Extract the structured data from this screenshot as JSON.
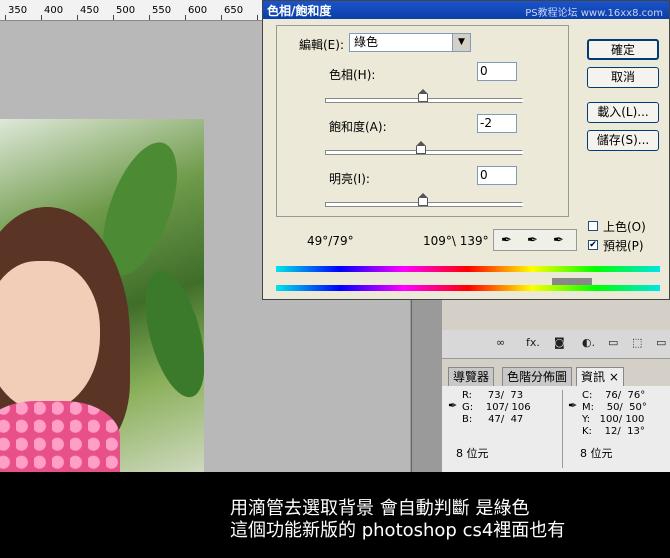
{
  "ruler": {
    "ticks": [
      "350",
      "400",
      "450",
      "500",
      "550",
      "600",
      "650"
    ]
  },
  "dialog": {
    "title": "色相/飽和度",
    "watermark": "PS教程论坛 www.16xx8.com",
    "edit_label": "編輯(E):",
    "edit_value": "綠色",
    "hue_label": "色相(H):",
    "hue_value": "0",
    "saturation_label": "飽和度(A):",
    "saturation_value": "-2",
    "lightness_label": "明亮(I):",
    "lightness_value": "0",
    "range_left": "49°/79°",
    "range_right": "109°\\ 139°",
    "ok_label": "確定",
    "cancel_label": "取消",
    "load_label": "載入(L)...",
    "save_label": "儲存(S)...",
    "colorize_label": "上色(O)",
    "preview_label": "預視(P)",
    "colorize_checked": false,
    "preview_checked": true
  },
  "panel": {
    "tabs": [
      "導覽器",
      "色階分佈圖",
      "資訊"
    ],
    "tab_close": "×",
    "toolbar_icons": [
      "∞",
      "fx.",
      "◙",
      "◐.",
      "▭",
      "⬚",
      "▭"
    ],
    "info_left": "R:     73/  73\nG:    107/ 106\nB:     47/  47",
    "info_right": "C:    76/  76°\nM:    50/  50°\nY:   100/ 100\nK:    12/  13°",
    "bits_left": "8 位元",
    "bits_right": "8 位元"
  },
  "caption": {
    "line1": "用滴管去選取背景 會自動判斷 是綠色",
    "line2": "這個功能新版的 photoshop cs4裡面也有"
  }
}
